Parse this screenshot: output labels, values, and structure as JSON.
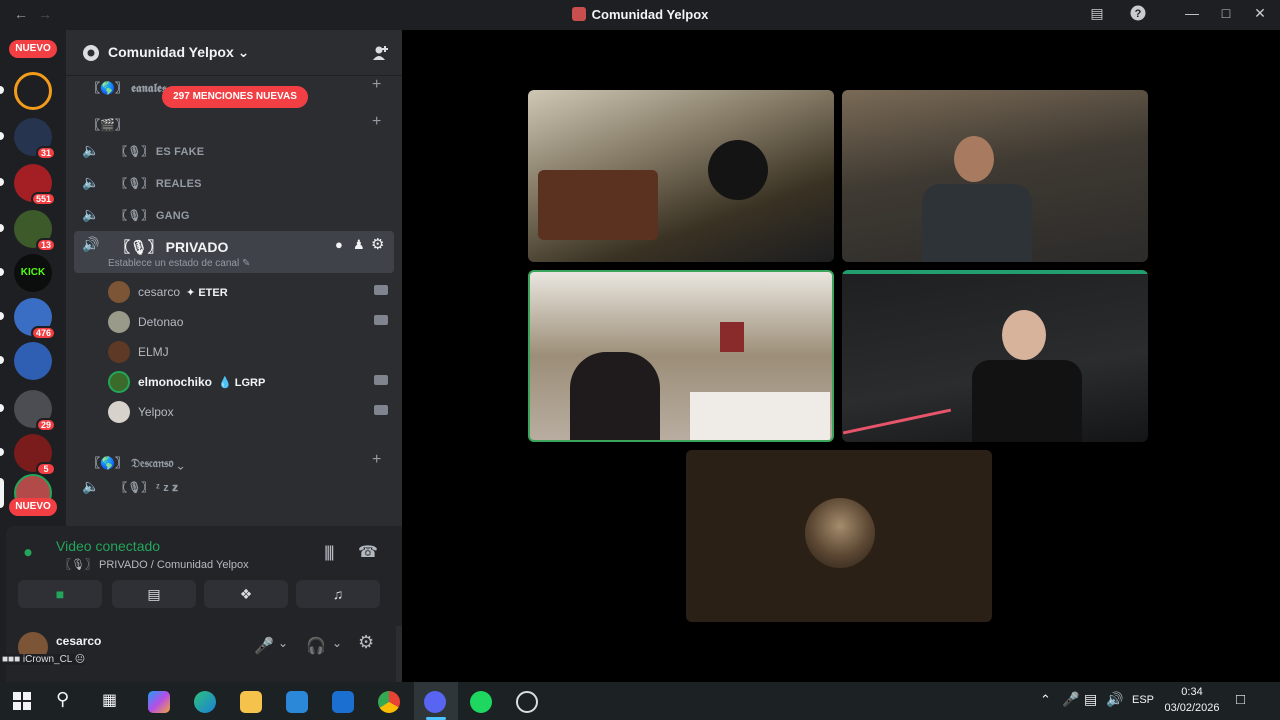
{
  "window": {
    "title": "Comunidad Yelpox"
  },
  "guilds": {
    "badges": [
      "31",
      "551",
      "13",
      "476",
      "29",
      "5"
    ],
    "nuevo_label": "NUEVO",
    "kick_label": "KICK"
  },
  "server": {
    "name": "Comunidad Yelpox",
    "mentions_banner": "297 MENCIONES NUEVAS",
    "category_1": "〖🌎〗 𝖊𝖆𝖓𝖆𝖑𝖊𝖘",
    "category_2": "〖🎬〗",
    "category_3": "〖🌎〗 𝔇𝔢𝔰𝔠𝔞𝔫𝔰𝔬"
  },
  "channels": [
    {
      "name": "〖🎙〗 ES FAKE"
    },
    {
      "name": "〖🎙〗 REALES"
    },
    {
      "name": "〖🎙〗 GANG"
    }
  ],
  "private_channel": {
    "name": "〖🎙〗 PRIVADO",
    "status_prompt": "Establece un estado de canal"
  },
  "members": [
    {
      "name": "cesarco",
      "tag": "ETER"
    },
    {
      "name": "Detonao",
      "tag": ""
    },
    {
      "name": "ELMJ",
      "tag": ""
    },
    {
      "name": "elmonochiko",
      "tag": "LGRP"
    },
    {
      "name": "Yelpox",
      "tag": ""
    }
  ],
  "rest_channel": "〖🎙〗 ᶻ z 𝐳",
  "voice": {
    "status": "Video conectado",
    "location": "〖🎙〗 PRIVADO / Comunidad Yelpox"
  },
  "user": {
    "name": "cesarco",
    "status_text": "iCrown_CL"
  },
  "taskbar": {
    "language": "ESP",
    "time": "0:34",
    "date": "03/02/2026"
  },
  "colors": {
    "accent_green": "#23a55a",
    "mention_red": "#f23f43",
    "tile_active_border": "#3ba55c"
  }
}
